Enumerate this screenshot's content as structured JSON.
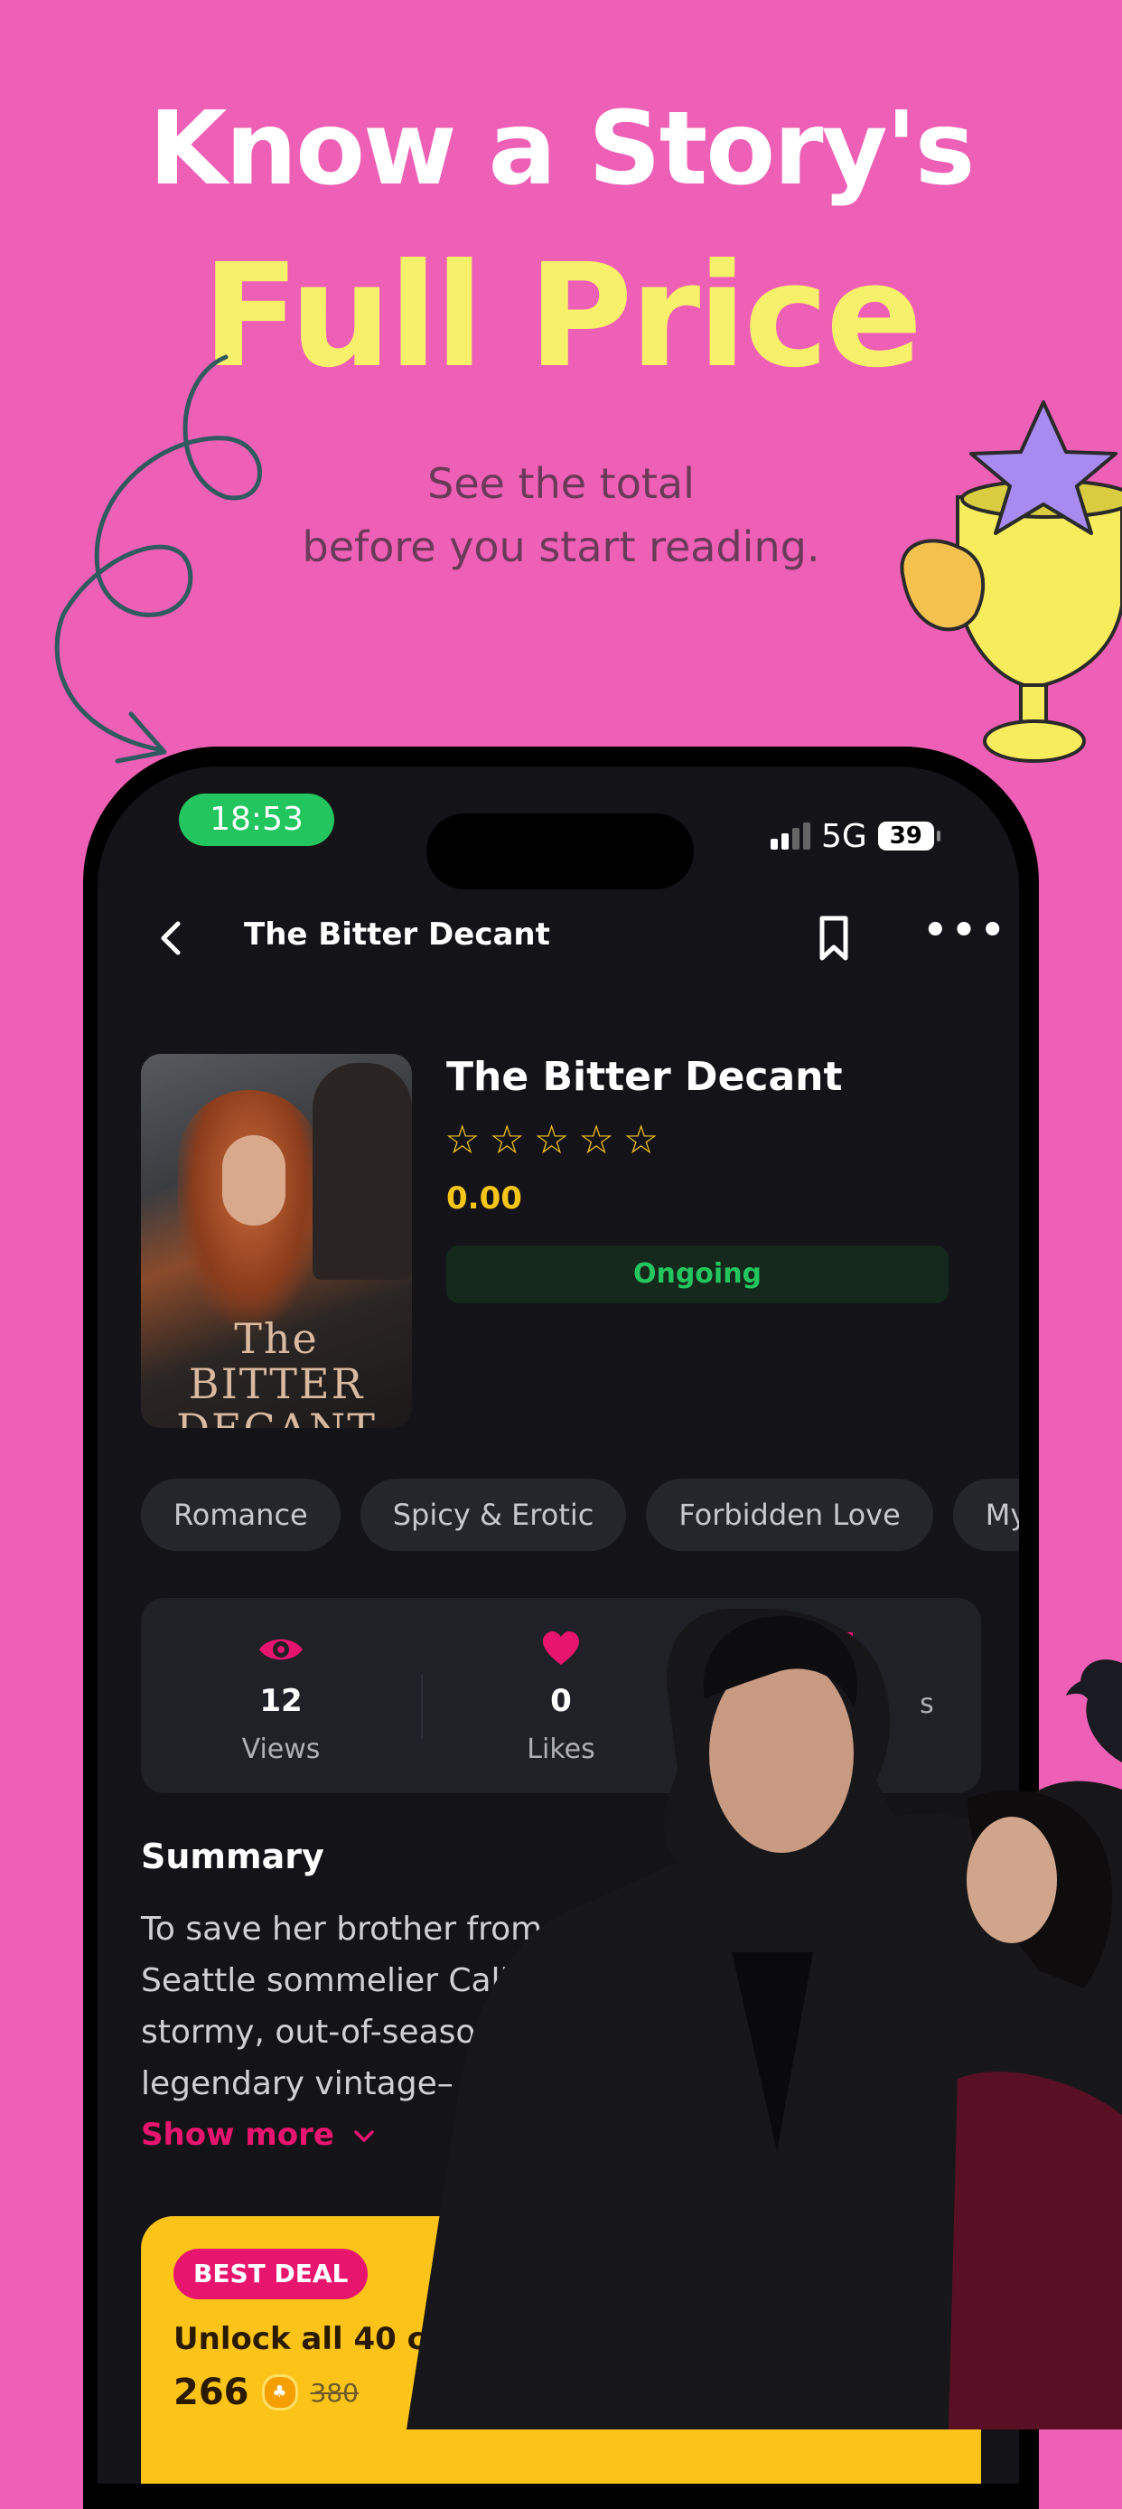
{
  "promo": {
    "headline_line1": "Know a Story's",
    "headline_line2": "Full Price",
    "subtitle": "See the total\nbefore you start reading."
  },
  "status_bar": {
    "time": "18:53",
    "network": "5G",
    "battery": "39"
  },
  "nav": {
    "title": "The Bitter Decant",
    "back_icon": "chevron-left-icon",
    "bookmark_icon": "bookmark-icon",
    "more_icon": "more-horizontal-icon",
    "more_glyph": "•••"
  },
  "book": {
    "cover_title": "The\nBITTER\nDECANT",
    "title": "The Bitter Decant",
    "rating_stars": 5,
    "rating": "0.00",
    "status": "Ongoing"
  },
  "tags": [
    "Romance",
    "Spicy & Erotic",
    "Forbidden Love",
    "My"
  ],
  "stats": [
    {
      "icon": "eye-icon",
      "value": "12",
      "label": "Views"
    },
    {
      "icon": "heart-icon",
      "value": "0",
      "label": "Likes"
    },
    {
      "icon": "bookmark-icon",
      "value": "",
      "label": "s"
    }
  ],
  "summary": {
    "title": "Summary",
    "text": "To save her brother from\nSeattle sommelier Calla\nstormy, out-of-seaso\nlegendary vintage–",
    "show_more": "Show more"
  },
  "deal": {
    "badge": "BEST DEAL",
    "text": "Unlock all 40 c",
    "price": "266",
    "old_price": "380"
  },
  "colors": {
    "background": "#ee5fb6",
    "accent_yellow": "#f7f06a",
    "accent_pink": "#e8156e",
    "status_green": "#22c55e",
    "star_gold": "#f5c518",
    "deal_yellow": "#fcc419"
  }
}
